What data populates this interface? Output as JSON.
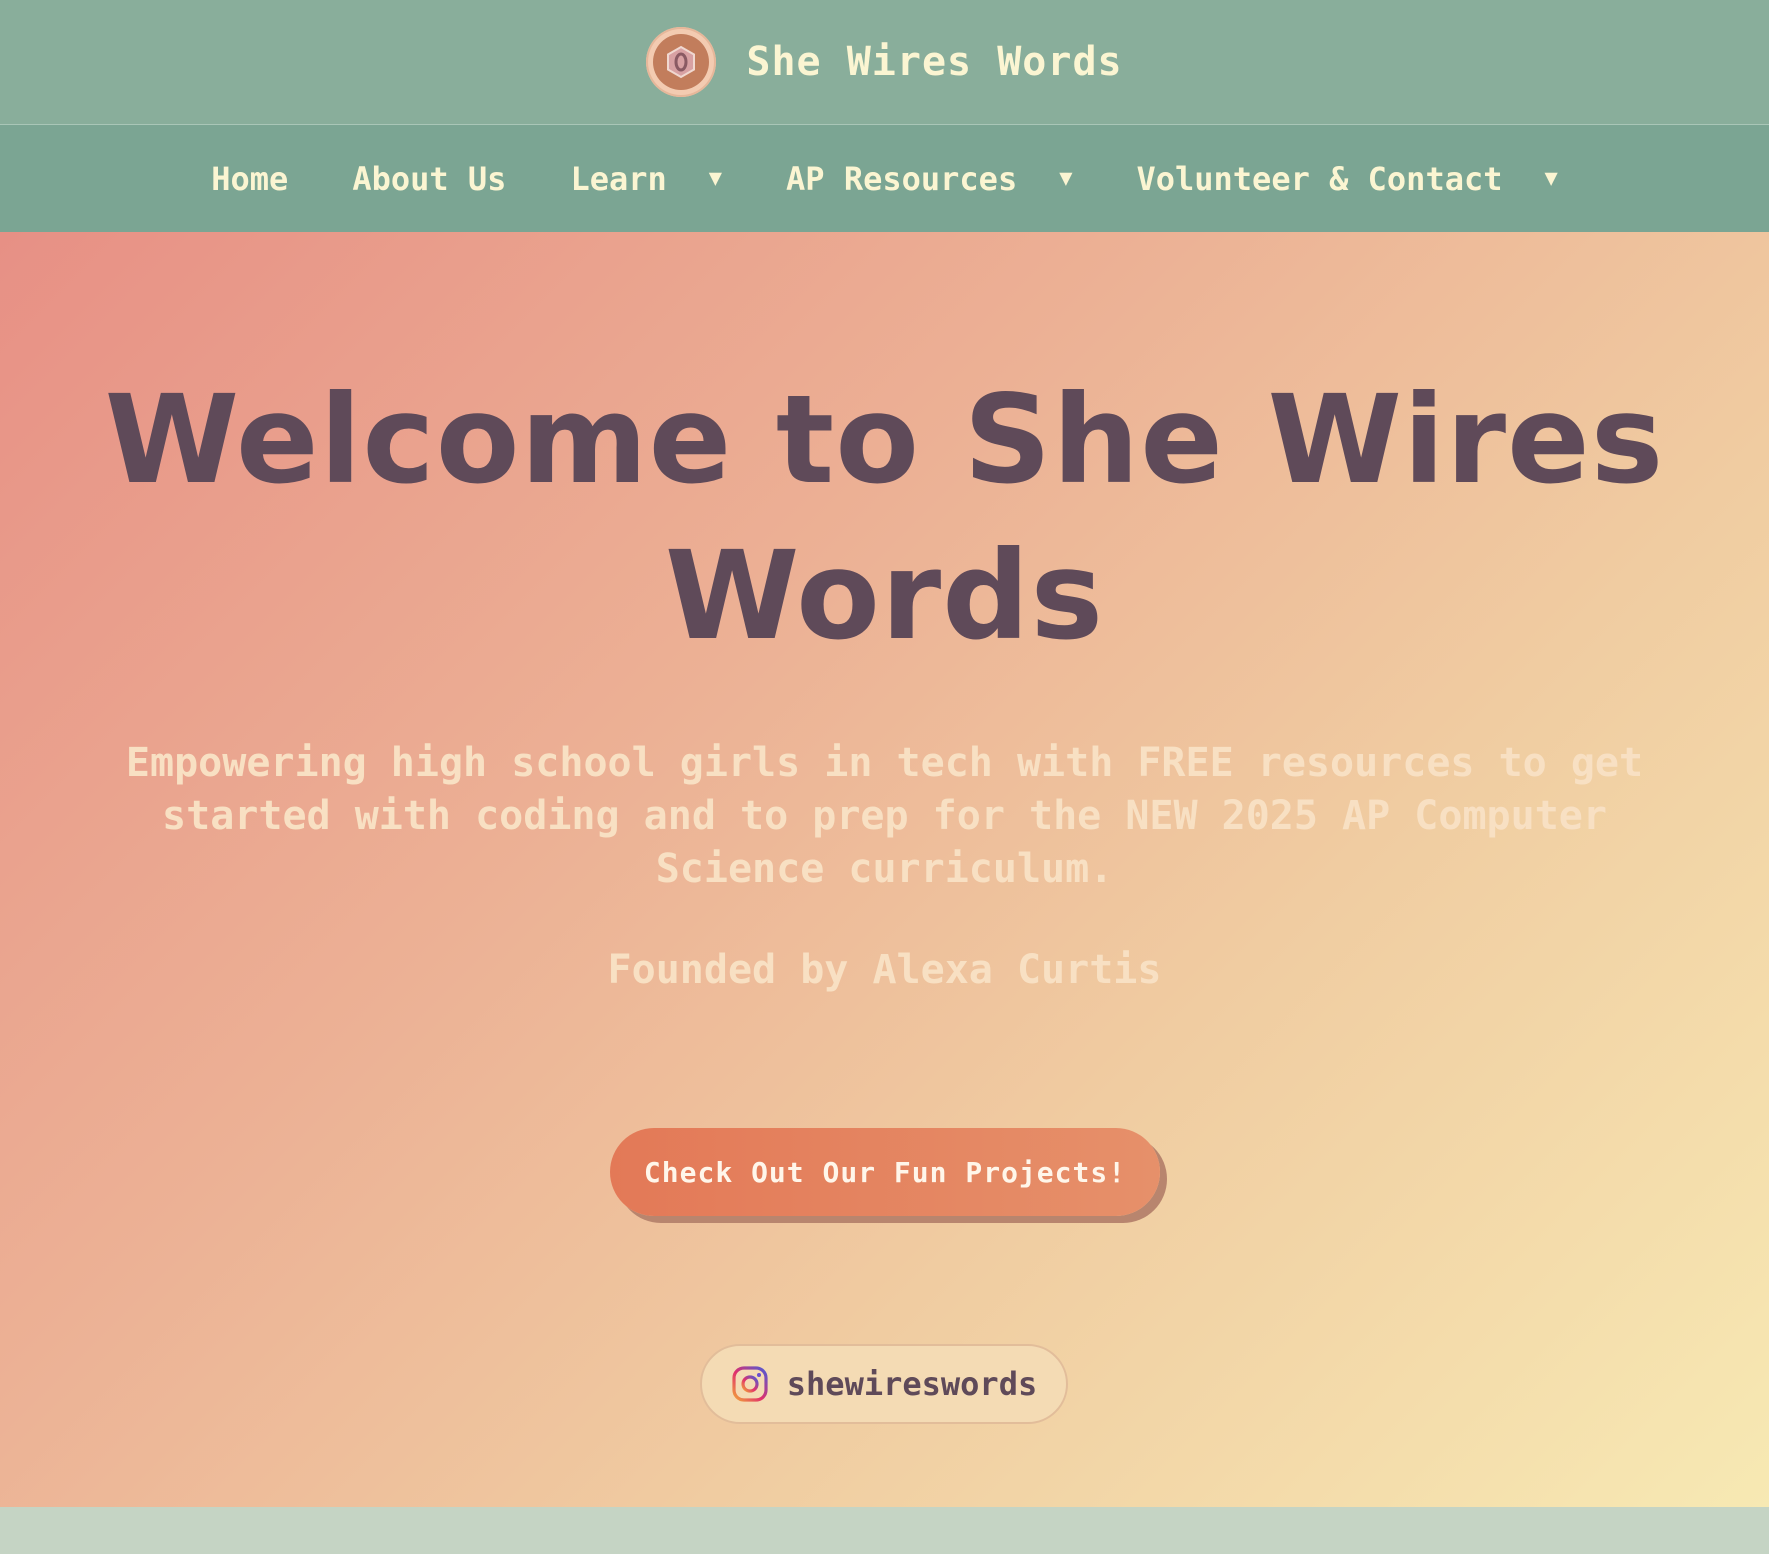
{
  "header": {
    "site_title": "She Wires Words",
    "logo_icon": "hex-nut-logo"
  },
  "nav": {
    "items": [
      {
        "label": "Home",
        "has_dropdown": false
      },
      {
        "label": "About Us",
        "has_dropdown": false
      },
      {
        "label": "Learn",
        "has_dropdown": true
      },
      {
        "label": "AP Resources",
        "has_dropdown": true
      },
      {
        "label": "Volunteer & Contact",
        "has_dropdown": true
      }
    ],
    "caret": "▼"
  },
  "hero": {
    "title_line1": "Welcome to She Wires",
    "title_line2": "Words",
    "tagline": "Empowering high school girls in tech with FREE resources to get started with coding and to prep for the NEW 2025 AP Computer Science curriculum.",
    "founder": "Founded by Alexa Curtis",
    "cta_label": "Check Out Our Fun Projects!",
    "instagram_handle": "shewireswords",
    "instagram_icon": "instagram-icon"
  },
  "colors": {
    "header_bg": "#89ae9b",
    "nav_bg": "#7ba593",
    "nav_text": "#fbf5d2",
    "title_text": "#5f4a59",
    "cta_bg": "#e37957",
    "footer_strip": "#c5d4c4"
  }
}
